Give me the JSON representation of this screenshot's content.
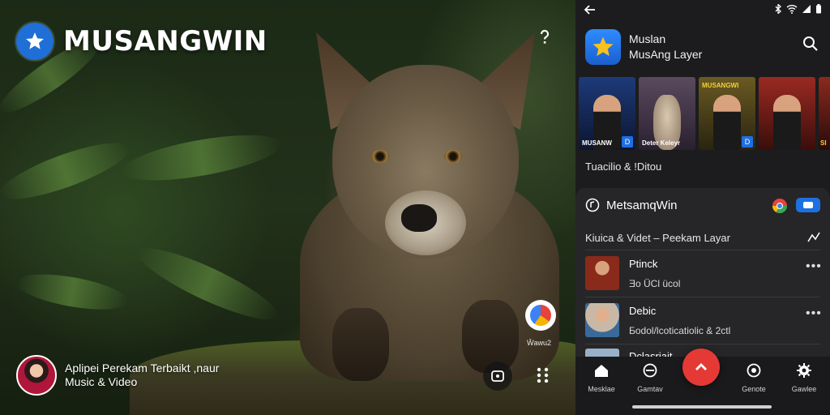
{
  "hero": {
    "brand_name": "MUSANGWIN",
    "caption_line1": "Aplipei Perekam Terbaikt ,naur",
    "caption_line2": "Music & Video",
    "pin_label": "Ŵawu2"
  },
  "phone": {
    "app_title_line1": "Muslan",
    "app_title_line2": "MusAng Layer",
    "thumbnails": [
      {
        "caption": "MUSANW",
        "badge": "D",
        "bg": "#1d3a7a"
      },
      {
        "caption": "Deter Keleyr",
        "badge": "",
        "bg": "#3a2a3f"
      },
      {
        "caption": "MUSANGWI",
        "badge": "D",
        "bg": "#4a3d1c"
      },
      {
        "caption": "",
        "badge": "",
        "bg": "#7a1f1a"
      },
      {
        "caption": "SI",
        "badge": "",
        "bg": "#6a1a16"
      }
    ],
    "section_label": "Tuacilio & !Ditou",
    "card": {
      "title": "MetsamqWin",
      "subtitle": "Kiuica & Videt – Peekam Layar",
      "tracks": [
        {
          "title": "Ptinck",
          "sub": "Ǝo ÜCl ücol",
          "color": "#8a2a1a"
        },
        {
          "title": "Debic",
          "sub": "Ƃodol/lcoticatiolic & 2ctl",
          "color": "#c9b8a6"
        },
        {
          "title": "Dclasriait",
          "sub": "",
          "color": "#9ab0c8"
        }
      ]
    },
    "nav": [
      {
        "label": "Mesklae",
        "icon": "home-icon"
      },
      {
        "label": "Gamtav",
        "icon": "explore-icon"
      },
      {
        "label": "Genote",
        "icon": "record-icon"
      },
      {
        "label": "Gawlee",
        "icon": "settings-icon"
      }
    ],
    "colors": {
      "accent": "#1e6fe0",
      "fab": "#e53935",
      "panel": "#1c1c1e"
    }
  }
}
